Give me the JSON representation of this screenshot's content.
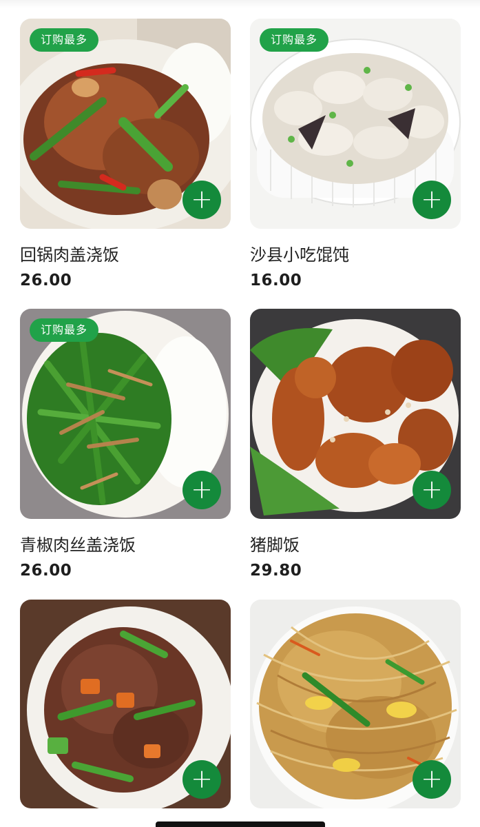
{
  "badge_text": "订购最多",
  "add_symbol": "+",
  "items": [
    {
      "name": "回锅肉盖浇饭",
      "price": "26.00",
      "badge": true,
      "image": "twice-cooked-pork-rice"
    },
    {
      "name": "沙县小吃馄饨",
      "price": "16.00",
      "badge": true,
      "image": "wonton-soup"
    },
    {
      "name": "青椒肉丝盖浇饭",
      "price": "26.00",
      "badge": true,
      "image": "pepper-pork-rice"
    },
    {
      "name": "猪脚饭",
      "price": "29.80",
      "badge": false,
      "image": "pork-trotter-rice"
    },
    {
      "name": "",
      "price": "",
      "badge": false,
      "image": "braised-pork-pepper-rice"
    },
    {
      "name": "",
      "price": "",
      "badge": false,
      "image": "fried-rice-noodles"
    }
  ],
  "colors": {
    "badge_bg": "#21a249",
    "add_button_bg": "#148a3b",
    "text_primary": "#222222"
  }
}
